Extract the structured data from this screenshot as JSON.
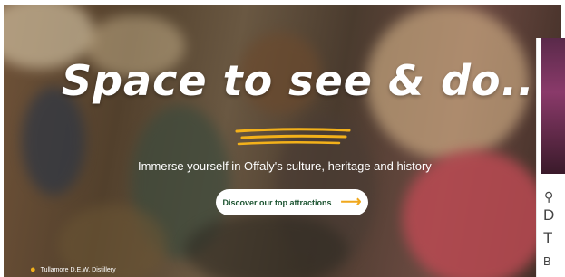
{
  "hero": {
    "title": "Space to see & do...",
    "subtitle": "Immerse yourself in Offaly's culture, heritage and history",
    "cta_label": "Discover our top attractions",
    "cta_icon": "arrow-right-icon",
    "location": "Tullamore D.E.W. Distillery",
    "location_icon": "map-pin-icon"
  },
  "side_card": {
    "line1": "D",
    "line2": "T",
    "line3": "B"
  },
  "colors": {
    "accent": "#f0a81d",
    "cta_text": "#1b5330"
  }
}
